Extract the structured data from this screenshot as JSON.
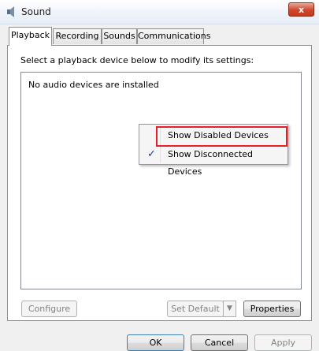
{
  "window": {
    "title": "Sound",
    "close_label": "x"
  },
  "tabs": [
    {
      "label": "Playback"
    },
    {
      "label": "Recording"
    },
    {
      "label": "Sounds"
    },
    {
      "label": "Communications"
    }
  ],
  "instruction": "Select a playback device below to modify its settings:",
  "device_list": {
    "empty_message": "No audio devices are installed"
  },
  "context_menu": {
    "items": [
      {
        "label": "Show Disabled Devices",
        "checked": false
      },
      {
        "label": "Show Disconnected Devices",
        "checked": true
      }
    ],
    "check_glyph": "✓"
  },
  "buttons": {
    "configure": "Configure",
    "set_default": "Set Default",
    "properties": "Properties",
    "ok": "OK",
    "cancel": "Cancel",
    "apply": "Apply"
  },
  "highlight_color": "#e8202a"
}
